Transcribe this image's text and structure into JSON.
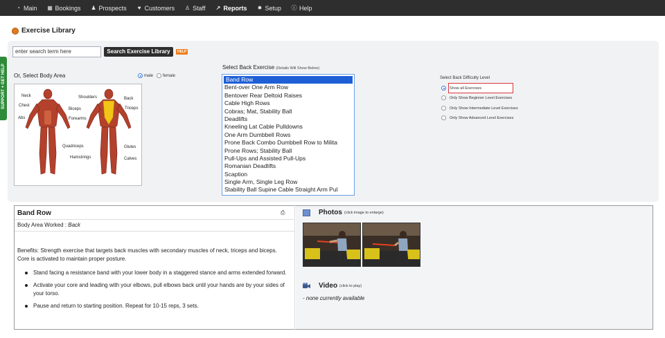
{
  "nav": {
    "items": [
      {
        "label": "Main",
        "icon": "dashboard-icon"
      },
      {
        "label": "Bookings",
        "icon": "calendar-icon"
      },
      {
        "label": "Prospects",
        "icon": "users-icon"
      },
      {
        "label": "Customers",
        "icon": "heart-icon"
      },
      {
        "label": "Staff",
        "icon": "user-icon"
      },
      {
        "label": "Reports",
        "icon": "chart-icon"
      },
      {
        "label": "Setup",
        "icon": "gear-icon"
      },
      {
        "label": "Help",
        "icon": "info-icon"
      }
    ],
    "active": "Reports"
  },
  "support_tab": "SUPPORT + GET HELP",
  "page_title": "Exercise Library",
  "search": {
    "value": "enter search term here",
    "button": "Search Exercise Library",
    "help": "HELP"
  },
  "body_area": {
    "label": "Or, Select Body Area",
    "genders": [
      {
        "label": "male",
        "selected": true
      },
      {
        "label": "female",
        "selected": false
      }
    ],
    "muscles": [
      "Neck",
      "Shoulders",
      "Back",
      "Chest",
      "Biceps",
      "Triceps",
      "Abs",
      "Forearms",
      "Quadriceps",
      "Glutes",
      "Hamstrings",
      "Calves"
    ]
  },
  "exercise_select": {
    "label": "Select Back Exercise",
    "note": "(Details Will Show Below)",
    "options": [
      "Band Row",
      "Bent-over One Arm Row",
      "Bentover Rear Deltoid Raises",
      "Cable High Rows",
      "Cobras; Mat, Stability Ball",
      "Deadlifts",
      "Kneeling Lat Cable Pulldowns",
      "One Arm Dumbbell Rows",
      "Prone Back Combo Dumbbell Row to Milita",
      "Prone Rows; Stability Ball",
      "Pull-Ups and Assisted Pull-Ups",
      "Romanian Deadlifts",
      "Scaption",
      "Single Arm, Single Leg Row",
      "Stability Ball Supine Cable Straight Arm Pul"
    ],
    "selected": "Band Row"
  },
  "difficulty": {
    "label": "Select Back Difficulty Level",
    "options": [
      {
        "label": "Show all Exercises",
        "selected": true
      },
      {
        "label": "Only Show Beginner Level Exercises",
        "selected": false
      },
      {
        "label": "Only Show Intermediate Level Exercises",
        "selected": false
      },
      {
        "label": "Only Show Advanced Level Exercises",
        "selected": false
      }
    ]
  },
  "detail": {
    "title": "Band Row",
    "area_label": "Body Area Worked : ",
    "area_value": "Back",
    "benefits": "Benefits: Strength exercise that targets back muscles with secondary muscles of neck, triceps and biceps. Core is activated to maintain proper posture.",
    "steps": [
      "Stand facing a resistance band with your lower body in a staggered stance and arms extended forward.",
      "Activate your core and leading with your elbows, pull elbows back until your hands are by your sides of your torso.",
      "Pause and return to starting position. Repeat for 10-15 reps, 3 sets."
    ]
  },
  "photos": {
    "label": "Photos",
    "note": "(click image to enlarge)"
  },
  "video": {
    "label": "Video",
    "note": "(click to play)",
    "none": "- none currently available"
  },
  "colors": {
    "nav_bg": "#2e2e2e",
    "selected_option": "#1f5fd6",
    "highlight_border": "#d9363e",
    "help_badge": "#f07d1a",
    "support_tab": "#2e8b3a"
  }
}
